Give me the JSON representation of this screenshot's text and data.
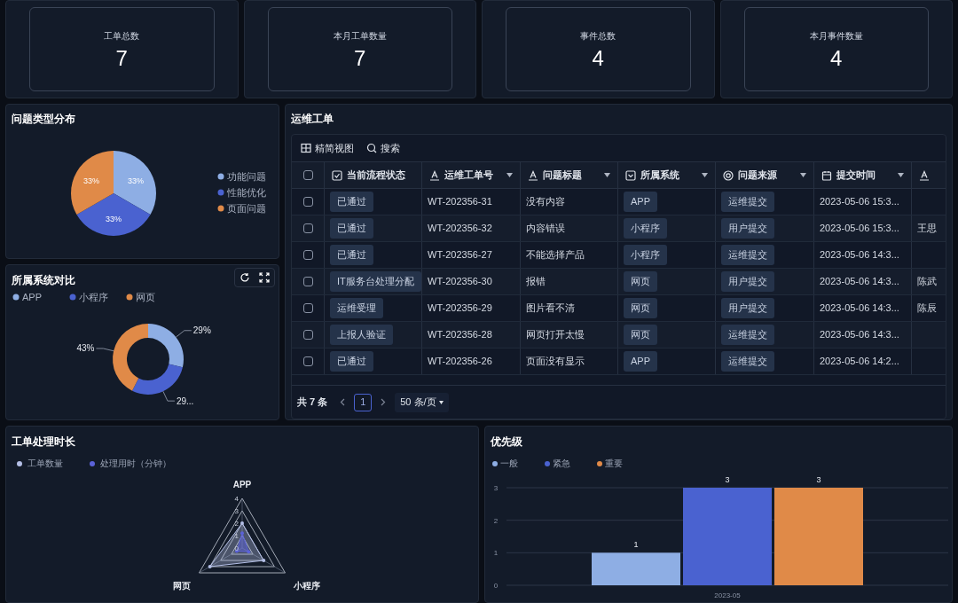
{
  "stats": [
    {
      "label": "工单总数",
      "value": "7"
    },
    {
      "label": "本月工单数量",
      "value": "7"
    },
    {
      "label": "事件总数",
      "value": "4"
    },
    {
      "label": "本月事件数量",
      "value": "4"
    }
  ],
  "type_panel": {
    "chart_data": {
      "type": "pie",
      "title": "问题类型分布",
      "categories": [
        "功能问题",
        "性能优化",
        "页面问题"
      ],
      "values": [
        33,
        33,
        33
      ],
      "value_labels": [
        "33%",
        "33%",
        "33%"
      ],
      "legend": "right"
    }
  },
  "system_panel": {
    "chart_data": {
      "type": "donut",
      "title": "所属系统对比",
      "categories": [
        "APP",
        "小程序",
        "网页"
      ],
      "values": [
        29,
        29,
        43
      ],
      "value_labels": [
        "29%",
        "29...",
        "43%"
      ],
      "legend": "top"
    }
  },
  "ticket_panel": {
    "title": "运维工单",
    "toolbar": [
      {
        "kind": "grid",
        "label": "精简视图"
      },
      {
        "kind": "search",
        "label": "搜索"
      }
    ],
    "header_checked": false,
    "columns": [
      {
        "kind": "checkbox",
        "label": "当前流程状态"
      },
      {
        "kind": "text",
        "label": "运维工单号"
      },
      {
        "kind": "text",
        "label": "问题标题"
      },
      {
        "kind": "select",
        "label": "所属系统"
      },
      {
        "kind": "radio",
        "label": "问题来源"
      },
      {
        "kind": "date",
        "label": "提交时间"
      },
      {
        "kind": "text"
      }
    ],
    "rows": [
      {
        "checked": false,
        "cells": [
          "已通过",
          "WT-202356-31",
          "没有内容",
          "APP",
          "运维提交",
          "2023-05-06 15:3..."
        ]
      },
      {
        "checked": false,
        "cells": [
          "已通过",
          "WT-202356-32",
          "内容错误",
          "小程序",
          "用户提交",
          "2023-05-06 15:3...",
          "王思"
        ]
      },
      {
        "checked": false,
        "cells": [
          "已通过",
          "WT-202356-27",
          "不能选择产品",
          "小程序",
          "运维提交",
          "2023-05-06 14:3..."
        ]
      },
      {
        "checked": false,
        "cells": [
          "IT服务台处理分配",
          "WT-202356-30",
          "报错",
          "网页",
          "用户提交",
          "2023-05-06 14:3...",
          "陈武"
        ]
      },
      {
        "checked": false,
        "cells": [
          "运维受理",
          "WT-202356-29",
          "图片看不清",
          "网页",
          "用户提交",
          "2023-05-06 14:3...",
          "陈辰"
        ]
      },
      {
        "checked": false,
        "cells": [
          "上报人验证",
          "WT-202356-28",
          "网页打开太慢",
          "网页",
          "运维提交",
          "2023-05-06 14:3..."
        ]
      },
      {
        "checked": false,
        "cells": [
          "已通过",
          "WT-202356-26",
          "页面没有显示",
          "APP",
          "运维提交",
          "2023-05-06 14:2..."
        ]
      }
    ],
    "pagination": {
      "total": "共 7 条",
      "pages": [
        {
          "label": "1",
          "selected": true
        }
      ],
      "page_size": "50 条/页"
    }
  },
  "duration_panel": {
    "title": "工单处理时长",
    "legend": [
      {
        "label": "工单数量",
        "color": "#b4bfe6"
      },
      {
        "label": "处理用时（分钟）",
        "color": "#5b62d8"
      }
    ],
    "axes": [
      "APP",
      "小程序",
      "网页"
    ],
    "ticks": [
      "4",
      "3",
      "2",
      "1",
      "0"
    ]
  },
  "priority_panel": {
    "chart_data": {
      "type": "bar",
      "title": "优先级",
      "categories": [
        "2023-05"
      ],
      "series": [
        {
          "name": "一般",
          "color": "#8eaee4",
          "values": [
            1
          ]
        },
        {
          "name": "紧急",
          "color": "#4a62d0",
          "values": [
            3
          ]
        },
        {
          "name": "重要",
          "color": "#e08a48",
          "values": [
            3
          ]
        }
      ],
      "ylim": [
        0,
        3
      ],
      "yticks": [
        0,
        1,
        2,
        3
      ],
      "data_labels": true
    }
  }
}
